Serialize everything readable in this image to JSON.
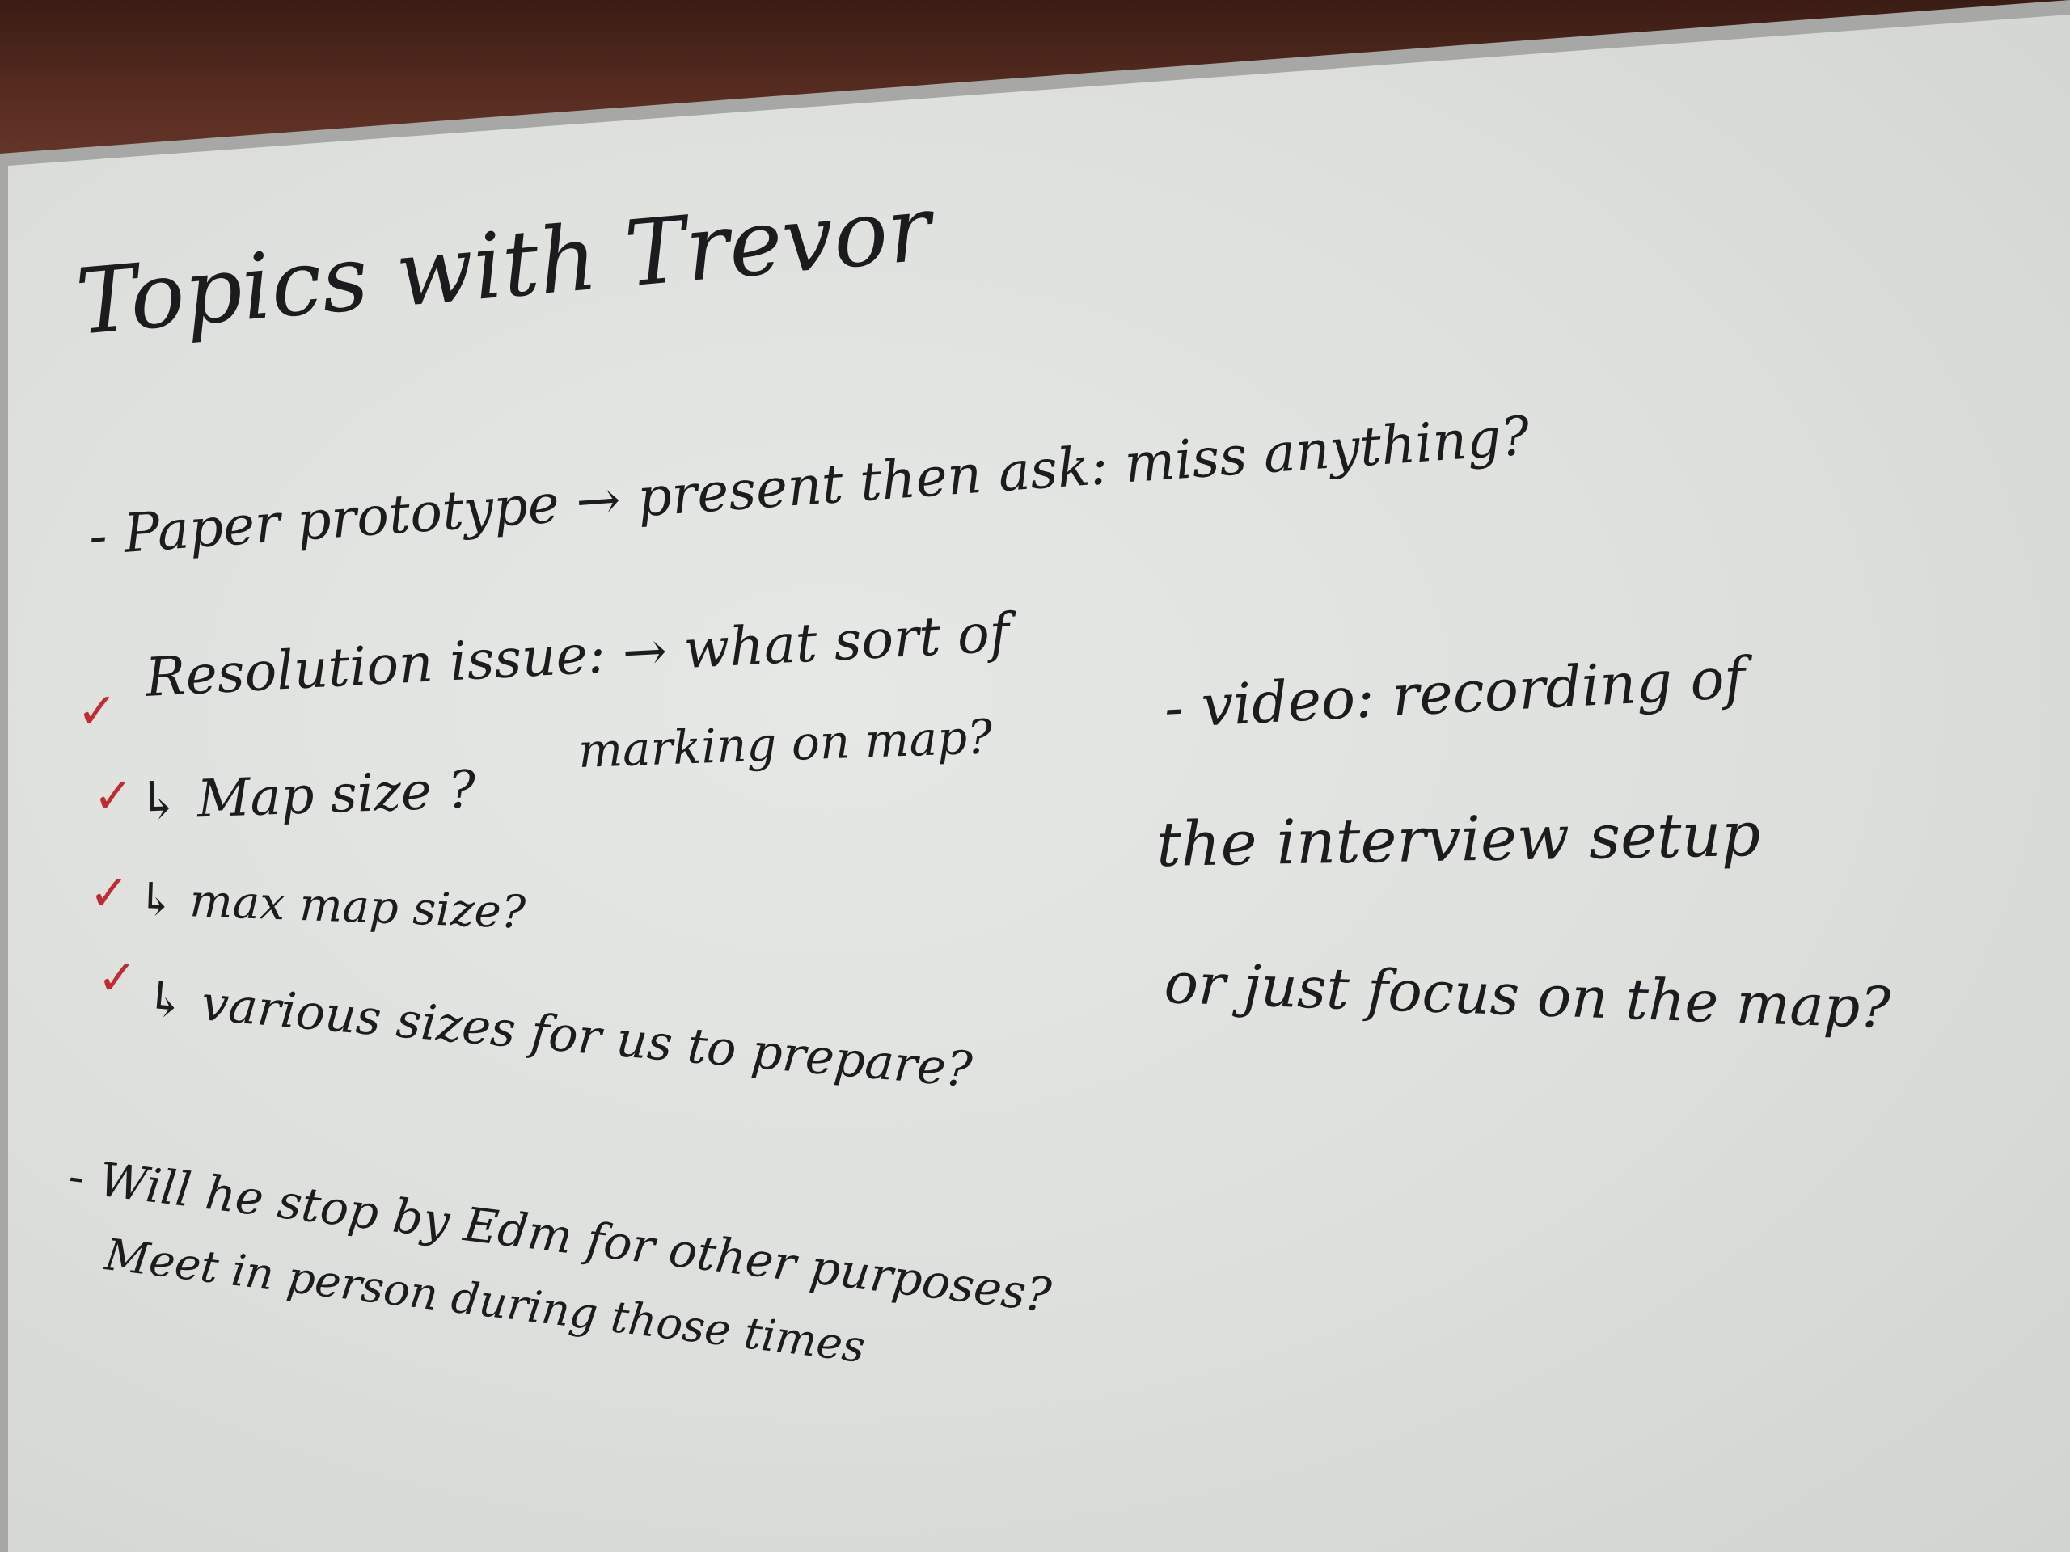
{
  "board": {
    "title": "Topics with Trevor",
    "items": [
      "- Paper prototype → present then ask: miss anything?",
      "Resolution issue: → what sort of",
      "marking on map?",
      "↳ Map size ?",
      "↳ max map size?",
      "↳ various sizes for us to prepare?",
      "- Will he stop by Edm for other purposes?",
      "Meet in person during those times"
    ],
    "right": [
      "- video: recording of",
      "the interview setup",
      "or just focus on the map?"
    ],
    "checkmark": "✓",
    "colors": {
      "marker": "#1c1c1e",
      "check": "#c32a35",
      "board": "#e2e4e1"
    }
  }
}
